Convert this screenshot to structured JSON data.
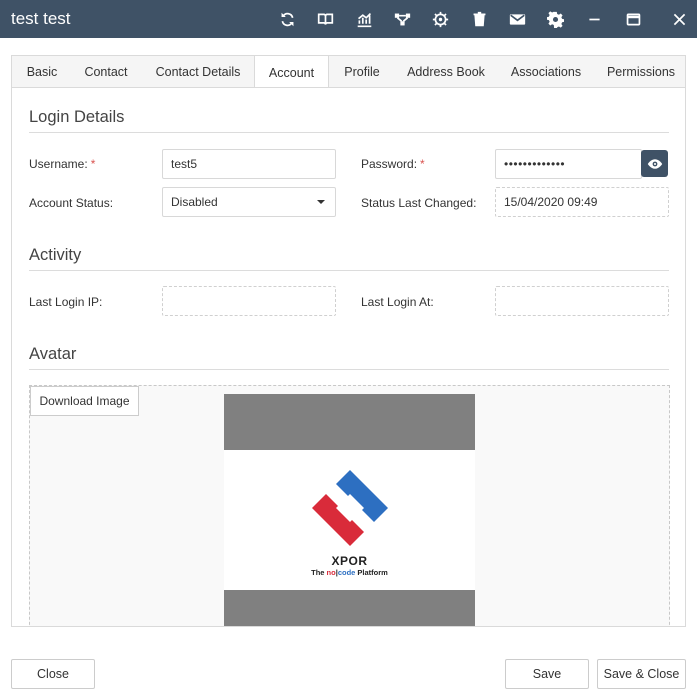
{
  "window": {
    "title": "test test",
    "icons": [
      "refresh-icon",
      "book-icon",
      "chart-icon",
      "flow-icon",
      "cog-gear-icon",
      "trash-icon",
      "mail-icon",
      "settings-icon",
      "minimize-icon",
      "maximize-icon",
      "close-icon"
    ]
  },
  "tabs": [
    {
      "label": "Basic"
    },
    {
      "label": "Contact"
    },
    {
      "label": "Contact Details"
    },
    {
      "label": "Account",
      "active": true
    },
    {
      "label": "Profile"
    },
    {
      "label": "Address Book"
    },
    {
      "label": "Associations"
    },
    {
      "label": "Permissions"
    }
  ],
  "login": {
    "heading": "Login Details",
    "username_label": "Username:",
    "username_value": "test5",
    "password_label": "Password:",
    "password_value": "•••••••••••••",
    "account_status_label": "Account Status:",
    "account_status_value": "Disabled",
    "status_changed_label": "Status Last Changed:",
    "status_changed_value": "15/04/2020 09:49",
    "required_mark": "*"
  },
  "activity": {
    "heading": "Activity",
    "last_ip_label": "Last Login IP:",
    "last_ip_value": "",
    "last_at_label": "Last Login At:",
    "last_at_value": ""
  },
  "avatar": {
    "heading": "Avatar",
    "download_label": "Download Image",
    "brand": "XPOR",
    "tagline_pre": "The ",
    "tagline_no": "no",
    "tagline_sep": "|",
    "tagline_code": "code",
    "tagline_post": " Platform"
  },
  "footer": {
    "close_label": "Close",
    "save_label": "Save",
    "save_close_label": "Save & Close"
  },
  "colors": {
    "titlebar": "#3f5266",
    "required": "#d9534f",
    "logo_red": "#d92b3a",
    "logo_blue": "#2d6fc1"
  }
}
